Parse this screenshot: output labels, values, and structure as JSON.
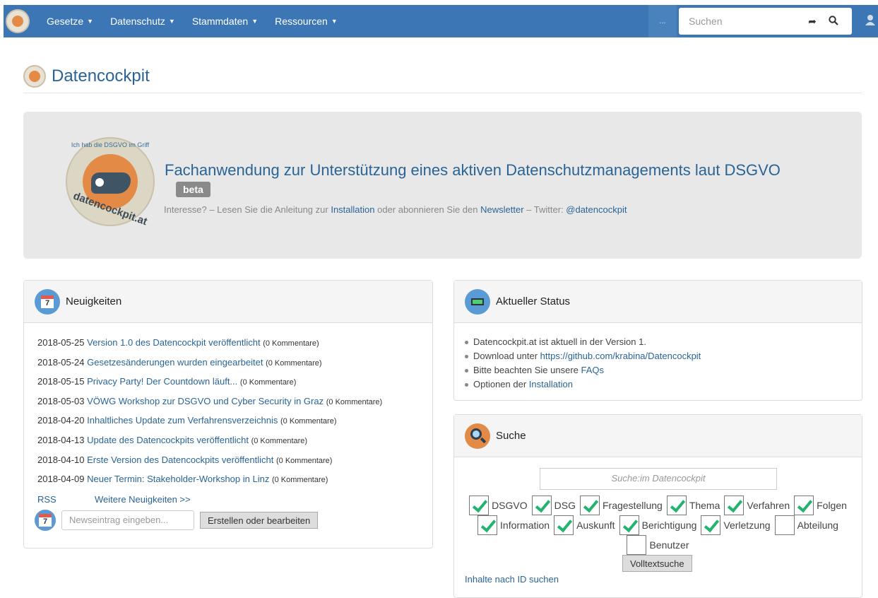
{
  "navbar": {
    "items": [
      {
        "label": "Gesetze"
      },
      {
        "label": "Datenschutz"
      },
      {
        "label": "Stammdaten"
      },
      {
        "label": "Ressourcen"
      }
    ],
    "more": "...",
    "search_placeholder": "Suchen"
  },
  "page": {
    "title": "Datencockpit"
  },
  "jumbotron": {
    "badge_top": "Ich hab die DSGVO im Griff",
    "badge_bottom": "datencockpit.at",
    "headline": "Fachanwendung zur Unterstützung eines aktiven Datenschutzmanagements laut DSGVO",
    "beta": "beta",
    "sub_prefix": "Interesse? – Lesen Sie die Anleitung zur ",
    "sub_link1": "Installation",
    "sub_mid": " oder abonnieren Sie den ",
    "sub_link2": "Newsletter",
    "sub_mid2": " – Twitter: ",
    "sub_link3": "@datencockpit"
  },
  "news": {
    "title": "Neuigkeiten",
    "calendar_day": "7",
    "items": [
      {
        "date": "2018-05-25",
        "title": "Version 1.0 des Datencockpit veröffentlicht",
        "comments": "(0 Kommentare)"
      },
      {
        "date": "2018-05-24",
        "title": "Gesetzesänderungen wurden eingearbeitet",
        "comments": "(0 Kommentare)"
      },
      {
        "date": "2018-05-15",
        "title": "Privacy Party! Der Countdown läuft...",
        "comments": "(0 Kommentare)"
      },
      {
        "date": "2018-05-03",
        "title": "VÖWG Workshop zur DSGVO und Cyber Security in Graz",
        "comments": "(0 Kommentare)"
      },
      {
        "date": "2018-04-20",
        "title": "Inhaltliches Update zum Verfahrensverzeichnis",
        "comments": "(0 Kommentare)"
      },
      {
        "date": "2018-04-13",
        "title": "Update des Datencockpits veröffentlicht",
        "comments": "(0 Kommentare)"
      },
      {
        "date": "2018-04-10",
        "title": "Erste Version des Datencockpits veröffentlicht",
        "comments": "(0 Kommentare)"
      },
      {
        "date": "2018-04-09",
        "title": "Neuer Termin: Stakeholder-Workshop in Linz",
        "comments": "(0 Kommentare)"
      }
    ],
    "rss": "RSS",
    "more": "Weitere Neuigkeiten >>",
    "input_placeholder": "Newseintrag eingeben...",
    "button": "Erstellen oder bearbeiten"
  },
  "status": {
    "title": "Aktueller Status",
    "line1": "Datencockpit.at ist aktuell in der Version 1.",
    "line2_prefix": "Download unter ",
    "line2_link": "https://github.com/krabina/Datencockpit",
    "line3_prefix": "Bitte beachten Sie unsere ",
    "line3_link": "FAQs",
    "line4_prefix": "Optionen der ",
    "line4_link": "Installation"
  },
  "search": {
    "title": "Suche",
    "placeholder": "Suche:im Datencockpit",
    "checks": [
      {
        "label": "DSGVO",
        "checked": true
      },
      {
        "label": "DSG",
        "checked": true
      },
      {
        "label": "Fragestellung",
        "checked": true
      },
      {
        "label": "Thema",
        "checked": true
      },
      {
        "label": "Verfahren",
        "checked": true
      },
      {
        "label": "Folgen",
        "checked": true
      },
      {
        "label": "Information",
        "checked": true
      },
      {
        "label": "Auskunft",
        "checked": true
      },
      {
        "label": "Berichtigung",
        "checked": true
      },
      {
        "label": "Verletzung",
        "checked": true
      },
      {
        "label": "Abteilung",
        "checked": false
      },
      {
        "label": "Benutzer",
        "checked": false
      }
    ],
    "button": "Volltextsuche",
    "id_link": "Inhalte nach ID suchen"
  },
  "colors": {
    "navbar": "#3c76b5",
    "link": "#2a6496",
    "check": "#22b36f",
    "accent_orange": "#e48a47"
  }
}
